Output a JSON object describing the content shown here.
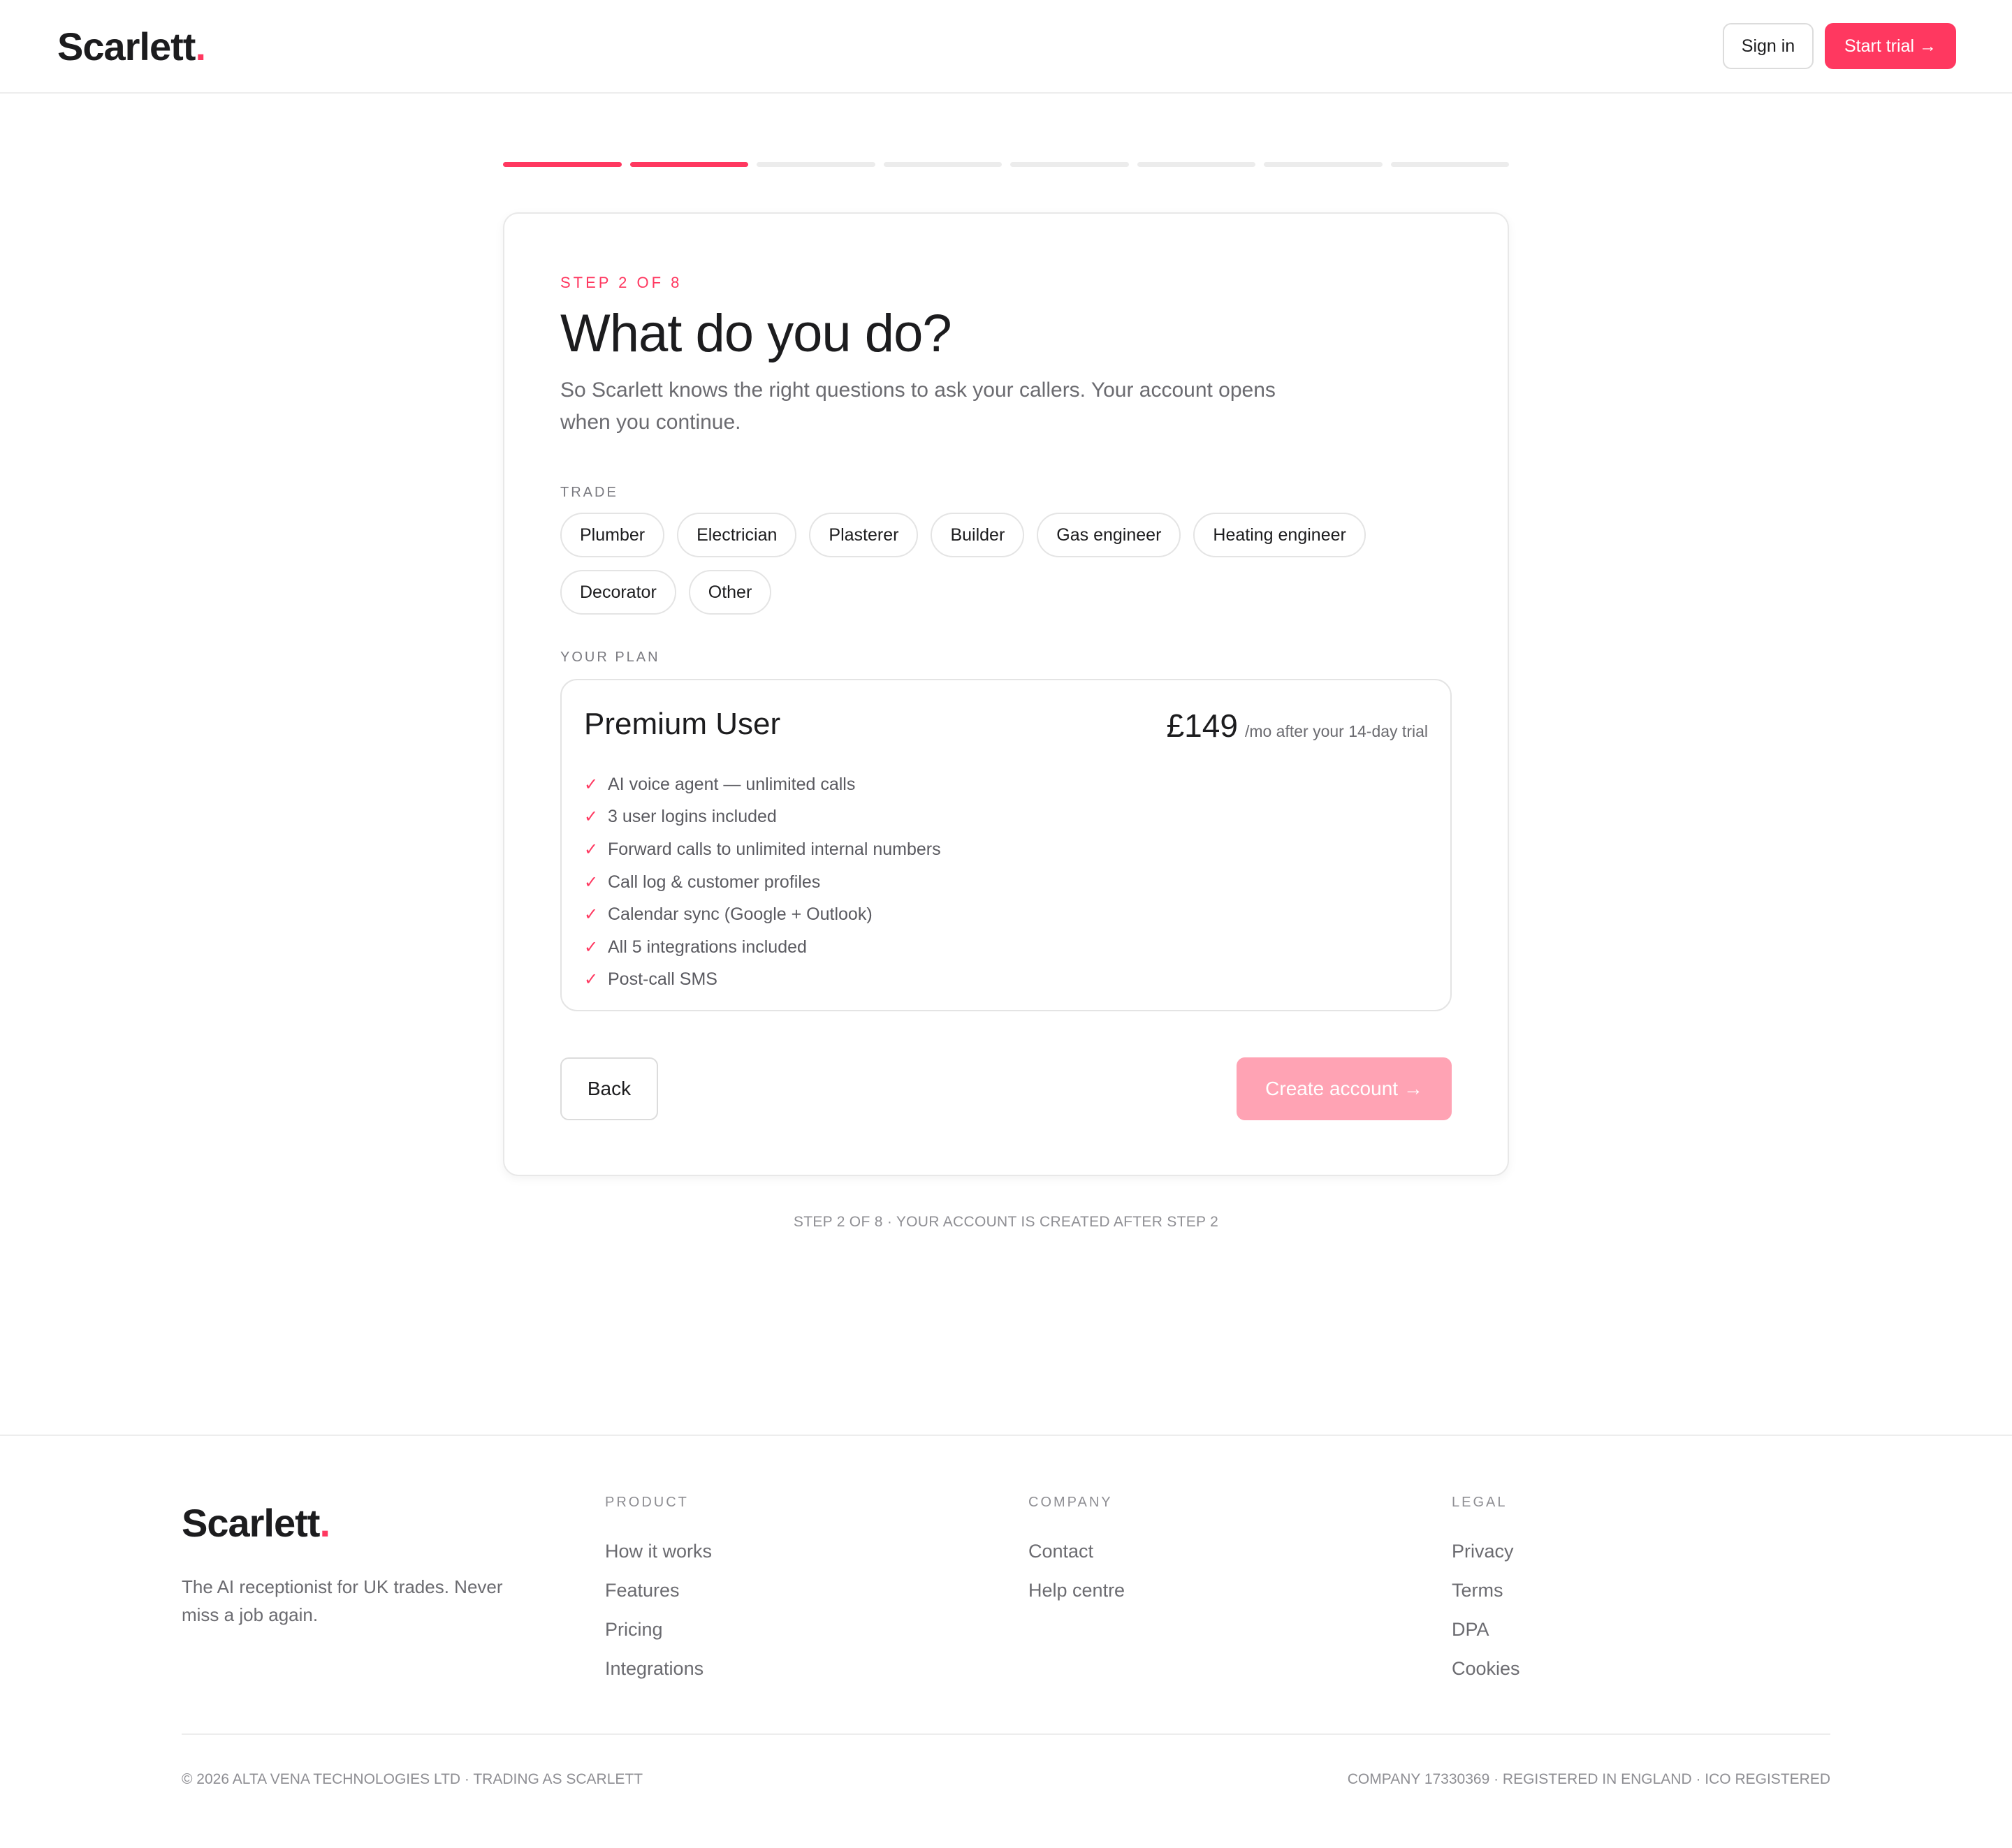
{
  "header": {
    "logo_text": "Scarlett",
    "logo_dot": ".",
    "sign_in": "Sign in",
    "start_trial": "Start trial →"
  },
  "progress": {
    "total_steps": 8,
    "completed_steps": 2
  },
  "card": {
    "step_label": "STEP 2 OF 8",
    "title": "What do you do?",
    "subtitle": "So Scarlett knows the right questions to ask your callers. Your account opens when you continue.",
    "trade_label": "TRADE",
    "trades": [
      "Plumber",
      "Electrician",
      "Plasterer",
      "Builder",
      "Gas engineer",
      "Heating engineer",
      "Decorator",
      "Other"
    ],
    "plan_label": "YOUR PLAN",
    "plan": {
      "name": "Premium User",
      "price": "£149",
      "price_note": "/mo after your 14-day trial",
      "features": [
        "AI voice agent — unlimited calls",
        "3 user logins included",
        "Forward calls to unlimited internal numbers",
        "Call log & customer profiles",
        "Calendar sync (Google + Outlook)",
        "All 5 integrations included",
        "Post-call SMS"
      ]
    },
    "back_label": "Back",
    "create_label": "Create account →"
  },
  "below_card_note": "STEP 2 OF 8 · YOUR ACCOUNT IS CREATED AFTER STEP 2",
  "footer": {
    "logo_text": "Scarlett",
    "logo_dot": ".",
    "tagline": "The AI receptionist for UK trades. Never miss a job again.",
    "columns": [
      {
        "title": "PRODUCT",
        "links": [
          "How it works",
          "Features",
          "Pricing",
          "Integrations"
        ]
      },
      {
        "title": "COMPANY",
        "links": [
          "Contact",
          "Help centre"
        ]
      },
      {
        "title": "LEGAL",
        "links": [
          "Privacy",
          "Terms",
          "DPA",
          "Cookies"
        ]
      }
    ],
    "copyright": "© 2026 ALTA VENA TECHNOLOGIES LTD · TRADING AS SCARLETT",
    "company_info": "COMPANY 17330369 · REGISTERED IN ENGLAND · ICO REGISTERED"
  },
  "colors": {
    "accent": "#ff3860",
    "accent_disabled": "#ffa3b4",
    "progress_inactive": "#ececec"
  },
  "icons": {
    "feature_check": "check-icon"
  }
}
